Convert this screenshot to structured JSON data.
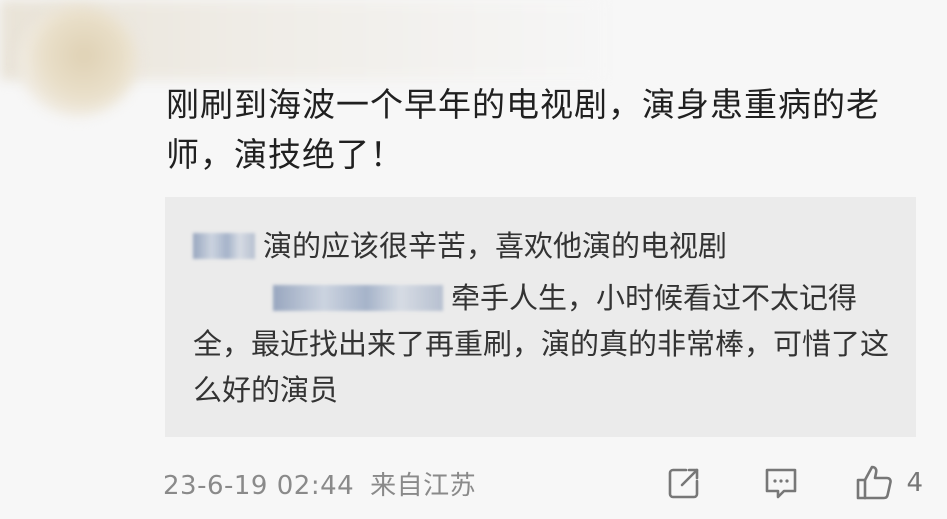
{
  "comment": {
    "text": "刚刷到海波一个早年的电视剧，演身患重病的老师，演技绝了！"
  },
  "replies": [
    {
      "text": "演的应该很辛苦，喜欢他演的电视剧"
    },
    {
      "text": "牵手人生，小时候看过不太记得全，最近找出来了再重刷，演的真的非常棒，可惜了这么好的演员"
    }
  ],
  "footer": {
    "timestamp": "23-6-19 02:44",
    "location": "来自江苏",
    "like_count": "4"
  },
  "icons": {
    "share": "share-icon",
    "comment": "comment-icon",
    "like": "thumbs-up-icon"
  }
}
